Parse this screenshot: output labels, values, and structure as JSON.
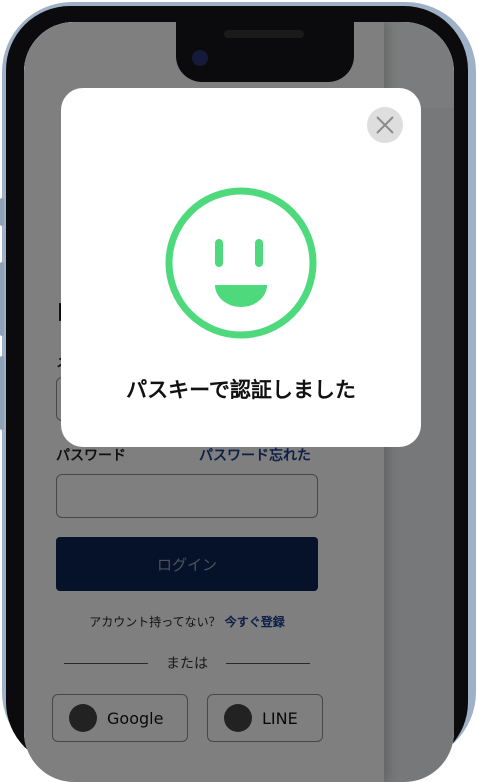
{
  "login_form": {
    "title": "ロ",
    "email_label": "メ",
    "password_label": "パスワード",
    "forgot_password_link": "パスワード忘れた",
    "login_button": "ログイン",
    "signup_prompt": "アカウント持ってない？",
    "signup_link": "今すぐ登録",
    "divider_text": "または",
    "social_google": "Google",
    "social_line": "LINE"
  },
  "modal": {
    "message": "パスキーで認証しました",
    "icon": "smiley-face-icon",
    "close_icon": "close-x-icon",
    "accent_color": "#4ed97d"
  }
}
